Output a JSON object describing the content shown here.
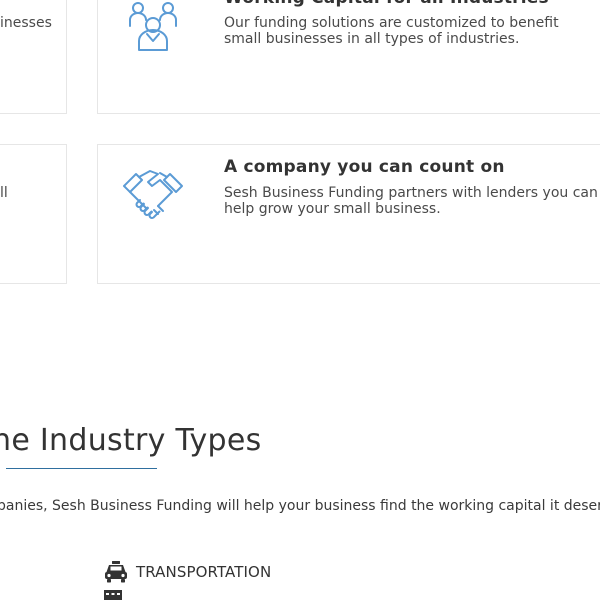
{
  "cards": {
    "top_left_snippet": "inesses",
    "bottom_left_snippet": "ll",
    "working_capital": {
      "title": "Working Capital for all Industries",
      "description": "Our funding solutions are customized to benefit small businesses in all types of industries.",
      "icon": "team-icon"
    },
    "company": {
      "title": "A company you can count on",
      "description_line1": "Sesh Business Funding partners with lenders you can trust to",
      "description_line2": "help grow your small business.",
      "icon": "handshake-icon"
    }
  },
  "industry_section": {
    "heading": "he Industry Types",
    "intro": "panies, Sesh Business Funding will help your business find the working capital it deserves.",
    "items": [
      {
        "label": "TRANSPORTATION",
        "icon": "taxi-icon"
      },
      {
        "label": "",
        "icon": "building-icon"
      }
    ]
  },
  "colors": {
    "accent": "#2f6f9f",
    "icon_blue": "#5b9bd5",
    "border": "#e6e6e6"
  }
}
